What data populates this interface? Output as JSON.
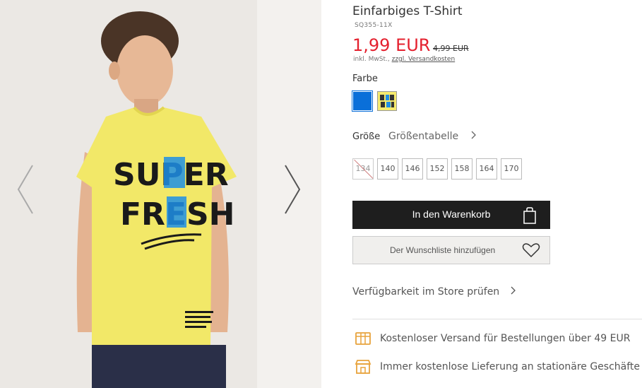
{
  "product": {
    "title": "Einfarbiges T-Shirt",
    "sku": "SQ355-11X",
    "price": "1,99 EUR",
    "old_price": "4,99 EUR",
    "vat_prefix": "inkl. MwSt.,",
    "shipping_link": "zzgl. Versandkosten",
    "print_line1": "SUPER",
    "print_line2": "FRESH"
  },
  "color": {
    "label": "Farbe",
    "swatches": [
      {
        "name": "blau",
        "hex": "#0a6fd9"
      },
      {
        "name": "gelb",
        "hex": "#f5ea6e"
      }
    ]
  },
  "size": {
    "label": "Größe",
    "chart_link": "Größentabelle",
    "options": [
      {
        "label": "134",
        "available": false
      },
      {
        "label": "140",
        "available": true
      },
      {
        "label": "146",
        "available": true
      },
      {
        "label": "152",
        "available": true
      },
      {
        "label": "158",
        "available": true
      },
      {
        "label": "164",
        "available": true
      },
      {
        "label": "170",
        "available": true
      }
    ]
  },
  "actions": {
    "add_to_cart": "In den Warenkorb",
    "wishlist": "Der Wunschliste hinzufügen",
    "store_check": "Verfügbarkeit im Store prüfen"
  },
  "benefits": [
    {
      "icon": "delivery-box-icon",
      "text": "Kostenloser Versand für Bestellungen über 49 EUR"
    },
    {
      "icon": "store-icon",
      "text": "Immer kostenlose Lieferung an stationäre Geschäfte"
    }
  ],
  "colors": {
    "accent_price": "#e4202e",
    "primary_button": "#1e1e1e",
    "icon_orange": "#e8a33c"
  }
}
